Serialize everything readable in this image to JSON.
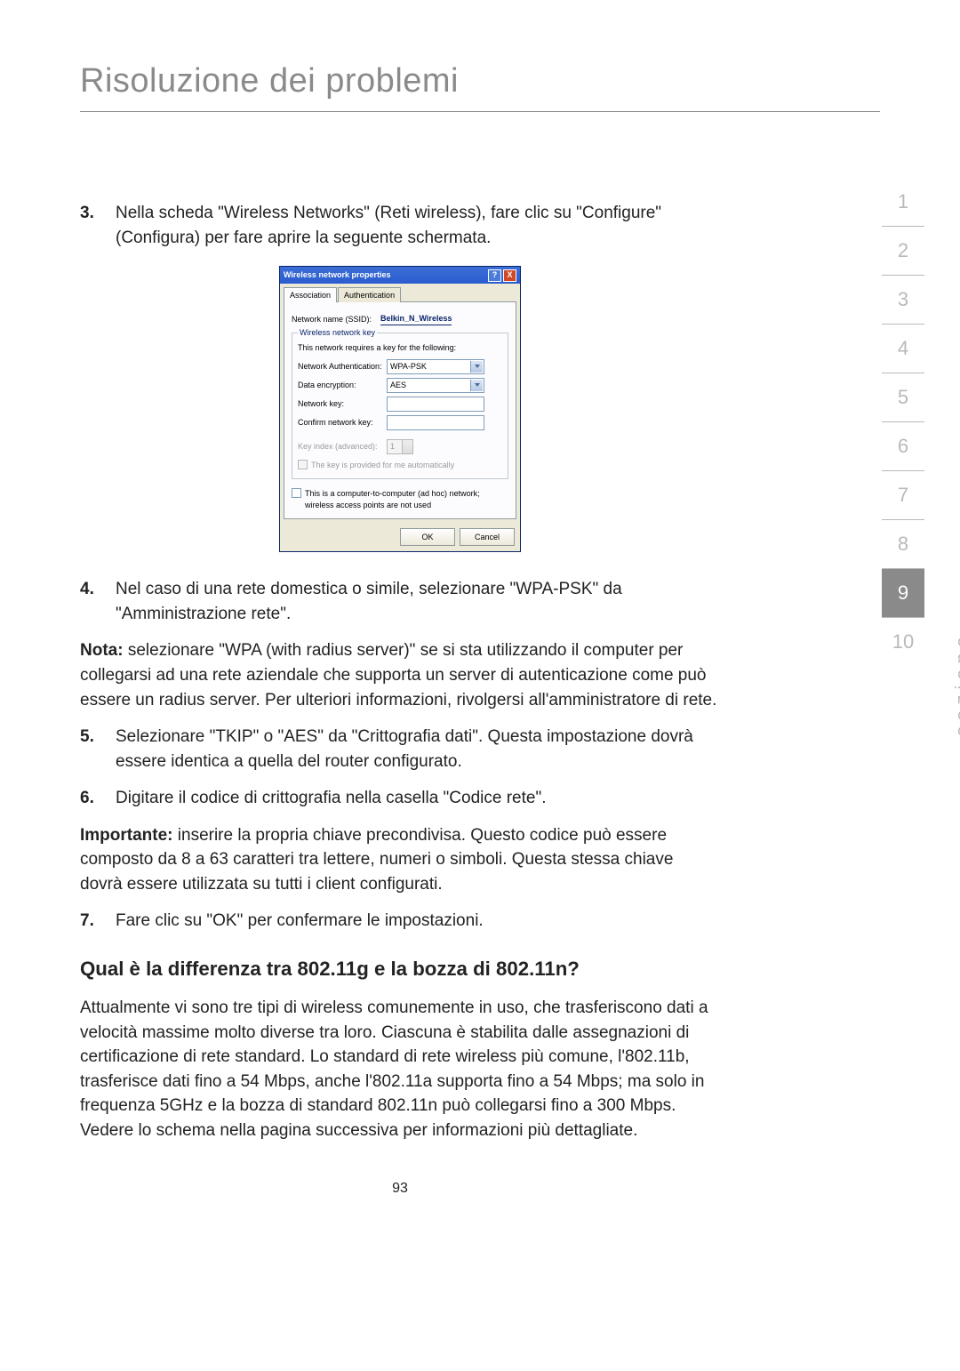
{
  "page": {
    "title": "Risoluzione dei problemi",
    "page_number": "93"
  },
  "sidenav": {
    "label": "sezione",
    "items": [
      "1",
      "2",
      "3",
      "4",
      "5",
      "6",
      "7",
      "8",
      "9",
      "10"
    ],
    "active_index": 8
  },
  "steps": {
    "s3": {
      "num": "3.",
      "text": "Nella scheda \"Wireless Networks\" (Reti wireless), fare clic su \"Configure\" (Configura) per fare aprire la seguente schermata."
    },
    "s4": {
      "num": "4.",
      "text": "Nel caso di una rete domestica o simile, selezionare \"WPA-PSK\" da \"Amministrazione rete\"."
    },
    "s5": {
      "num": "5.",
      "text": "Selezionare \"TKIP\" o \"AES\" da \"Crittografia dati\". Questa impostazione dovrà essere identica a quella del router configurato."
    },
    "s6": {
      "num": "6.",
      "text": "Digitare il codice di crittografia nella casella \"Codice rete\"."
    },
    "s7": {
      "num": "7.",
      "text": "Fare clic su \"OK\" per confermare le impostazioni."
    }
  },
  "note": {
    "label": "Nota:",
    "text": " selezionare \"WPA (with radius server)\" se si sta utilizzando il computer per collegarsi ad una rete aziendale che supporta un server di autenticazione come può essere un radius server. Per ulteriori informazioni, rivolgersi all'amministratore di rete."
  },
  "important": {
    "label": "Importante:",
    "text": " inserire la propria chiave precondivisa. Questo codice può essere composto da 8 a 63 caratteri tra lettere, numeri o simboli. Questa stessa chiave dovrà essere utilizzata su tutti i client configurati."
  },
  "subheading": "Qual è la differenza tra 802.11g e la bozza di 802.11n?",
  "body_para": "Attualmente vi sono tre tipi di wireless comunemente in uso, che trasferiscono dati a velocità massime molto diverse tra loro. Ciascuna è stabilita dalle assegnazioni di certificazione di rete standard. Lo standard di rete wireless più comune, l'802.11b, trasferisce dati fino a 54 Mbps, anche l'802.11a supporta fino a 54 Mbps; ma solo in frequenza 5GHz e la bozza di standard 802.11n può collegarsi fino a 300 Mbps. Vedere lo schema nella pagina successiva per informazioni più dettagliate.",
  "dialog": {
    "title": "Wireless network properties",
    "help_glyph": "?",
    "close_glyph": "X",
    "tabs": {
      "association": "Association",
      "authentication": "Authentication"
    },
    "fields": {
      "ssid_label": "Network name (SSID):",
      "ssid_value": "Belkin_N_Wireless",
      "fieldset_legend": "Wireless network key",
      "fieldset_info": "This network requires a key for the following:",
      "auth_label": "Network Authentication:",
      "auth_value": "WPA-PSK",
      "enc_label": "Data encryption:",
      "enc_value": "AES",
      "key_label": "Network key:",
      "confirm_label": "Confirm network key:",
      "keyidx_label": "Key index (advanced):",
      "keyidx_value": "1",
      "autokey_label": "The key is provided for me automatically",
      "adhoc_label": "This is a computer-to-computer (ad hoc) network; wireless access points are not used"
    },
    "buttons": {
      "ok": "OK",
      "cancel": "Cancel"
    }
  }
}
